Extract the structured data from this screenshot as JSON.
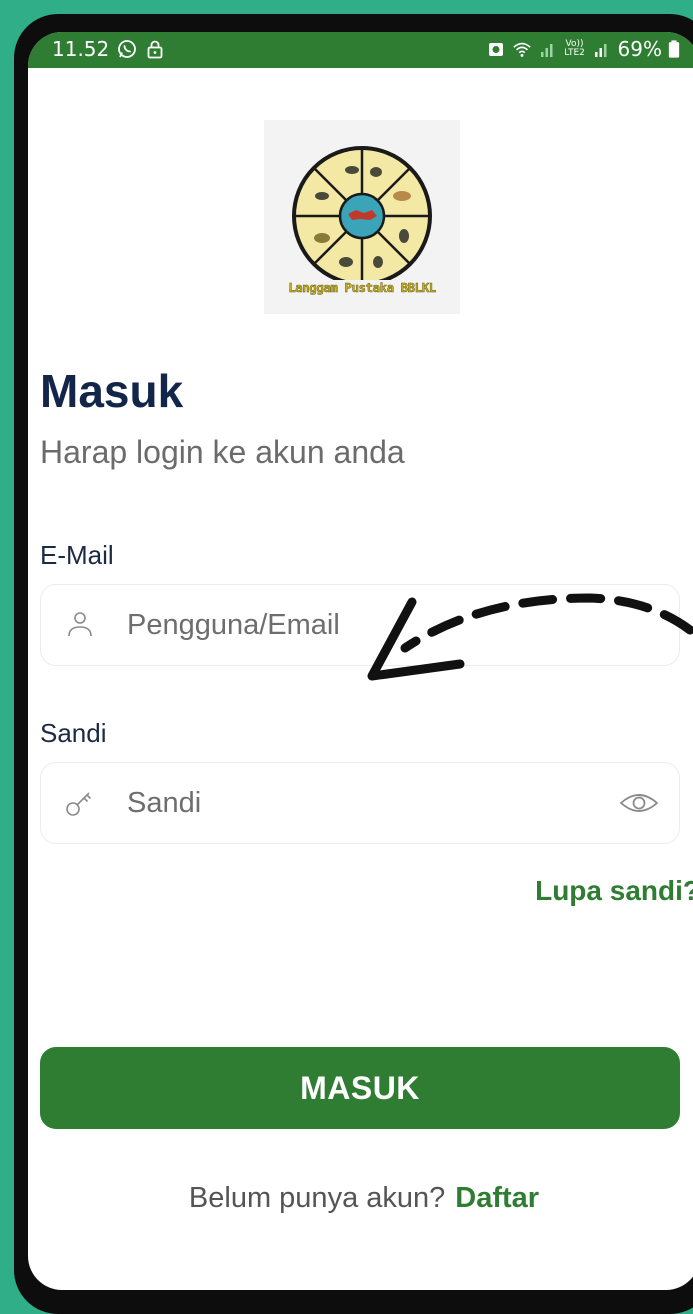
{
  "status_bar": {
    "time": "11.52",
    "volte_label": "Vo)) LTE2",
    "battery_percent": "69%"
  },
  "logo": {
    "caption": "Langgam Pustaka BBLKL"
  },
  "login": {
    "title": "Masuk",
    "subtitle": "Harap login ke akun anda",
    "email_label": "E-Mail",
    "email_placeholder": "Pengguna/Email",
    "password_label": "Sandi",
    "password_placeholder": "Sandi",
    "forgot_link": "Lupa sandi?",
    "submit_label": "MASUK",
    "register_prompt": "Belum punya akun?",
    "register_link": "Daftar"
  },
  "colors": {
    "brand_green": "#2e7d32",
    "page_background": "#2fae87",
    "title_navy": "#13264a"
  },
  "icons": {
    "status_left": [
      "whatsapp-icon",
      "lock-icon"
    ],
    "status_right": [
      "battery-saver-icon",
      "wifi-icon",
      "signal-icon",
      "signal-icon",
      "battery-icon"
    ],
    "email_field": "user-icon",
    "password_field": "key-icon",
    "password_toggle": "eye-icon"
  }
}
